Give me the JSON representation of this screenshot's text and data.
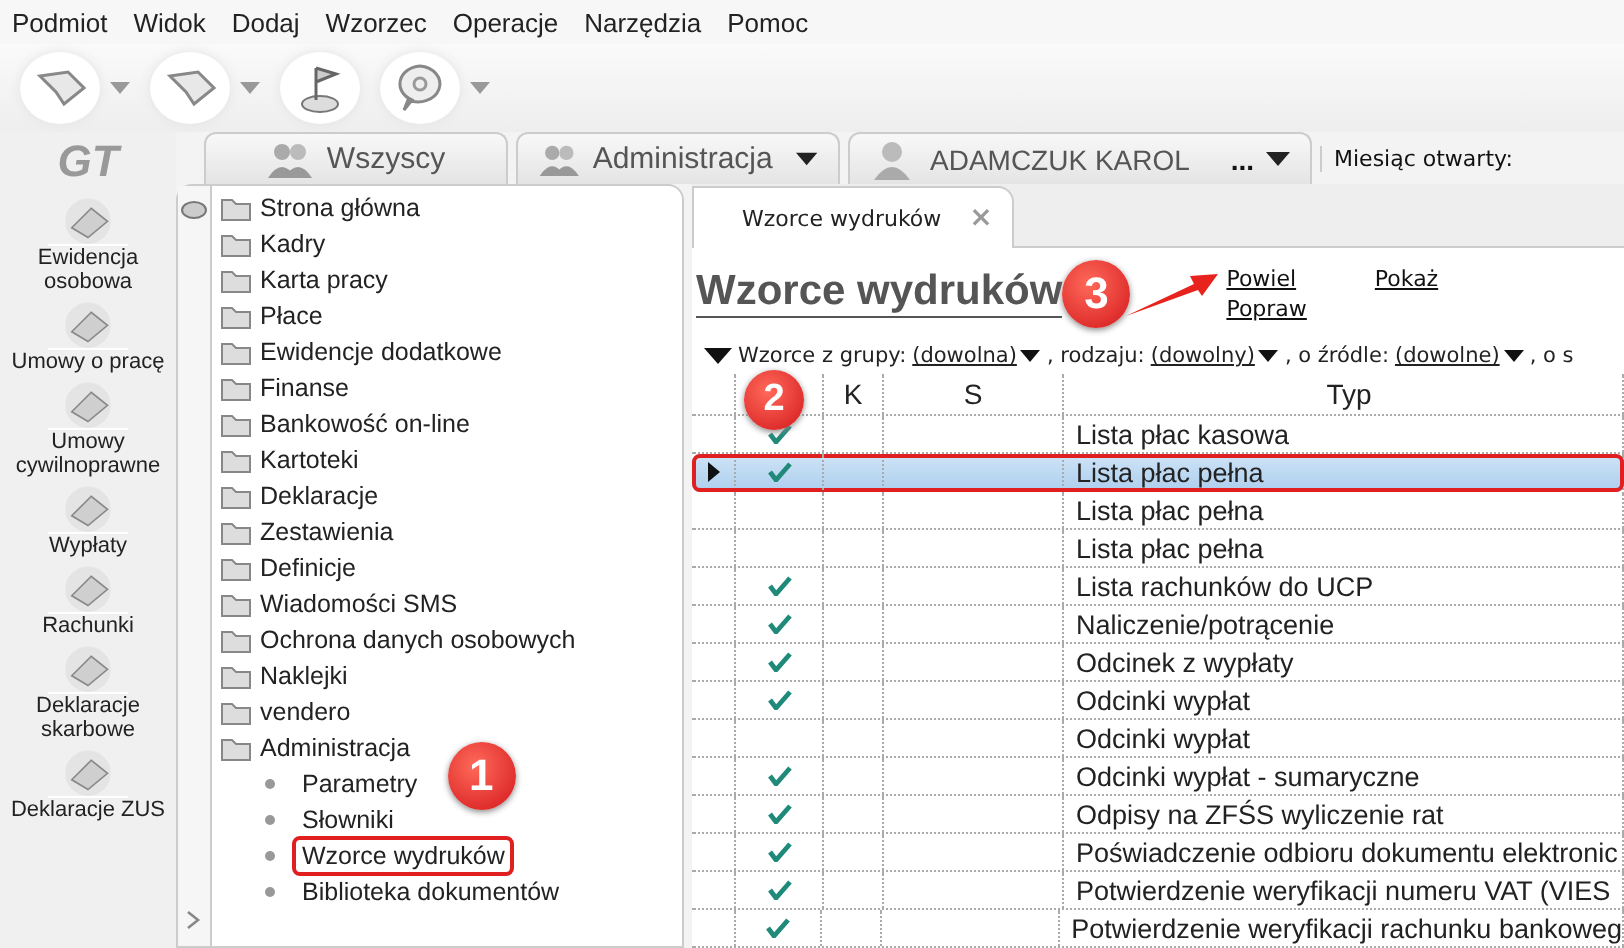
{
  "menu": [
    "Podmiot",
    "Widok",
    "Dodaj",
    "Wzorzec",
    "Operacje",
    "Narzędzia",
    "Pomoc"
  ],
  "toolbar": [
    {
      "kind": "arrow",
      "dropdown": true
    },
    {
      "kind": "arrow",
      "dropdown": true
    },
    {
      "kind": "flag",
      "dropdown": false
    },
    {
      "kind": "help",
      "dropdown": true
    }
  ],
  "top_tabs": [
    {
      "label": "Wszyscy",
      "kind": "group",
      "dropdown": false
    },
    {
      "label": "Administracja",
      "kind": "group",
      "dropdown": true
    },
    {
      "label": "ADAMCZUK KAROL",
      "kind": "person",
      "dropdown": true,
      "extra": "..."
    }
  ],
  "logo": "GT",
  "month_label": "Miesiąc otwarty:",
  "sidebar": [
    {
      "label": "Ewidencja osobowa"
    },
    {
      "label": "Umowy o pracę"
    },
    {
      "label": "Umowy cywilnoprawne"
    },
    {
      "label": "Wypłaty"
    },
    {
      "label": "Rachunki"
    },
    {
      "label": "Deklaracje skarbowe"
    },
    {
      "label": "Deklaracje ZUS"
    }
  ],
  "tree": [
    {
      "label": "Strona główna"
    },
    {
      "label": "Kadry"
    },
    {
      "label": "Karta pracy"
    },
    {
      "label": "Płace"
    },
    {
      "label": "Ewidencje dodatkowe"
    },
    {
      "label": "Finanse"
    },
    {
      "label": "Bankowość on-line"
    },
    {
      "label": "Kartoteki"
    },
    {
      "label": "Deklaracje"
    },
    {
      "label": "Zestawienia"
    },
    {
      "label": "Definicje"
    },
    {
      "label": "Wiadomości SMS"
    },
    {
      "label": "Ochrona danych osobowych"
    },
    {
      "label": "Naklejki"
    },
    {
      "label": "vendero"
    },
    {
      "label": "Administracja",
      "children": [
        {
          "label": "Parametry",
          "highlighted": false,
          "badge": "1"
        },
        {
          "label": "Słowniki",
          "highlighted": false
        },
        {
          "label": "Wzorce wydruków",
          "highlighted": true
        },
        {
          "label": "Biblioteka dokumentów",
          "highlighted": false
        }
      ]
    }
  ],
  "doc_tab": {
    "label": "Wzorce wydruków",
    "close": "×"
  },
  "title": "Wzorce wydruków",
  "title_badge": "3",
  "links": [
    {
      "label": "Powiel"
    },
    {
      "label": "Popraw"
    },
    {
      "label": "Pokaż"
    }
  ],
  "filter": [
    {
      "kind": "text",
      "label": "Wzorce z grupy:"
    },
    {
      "kind": "dropdown",
      "label": "(dowolna)"
    },
    {
      "kind": "text",
      "label": ", rodzaju:"
    },
    {
      "kind": "dropdown",
      "label": "(dowolny)"
    },
    {
      "kind": "text",
      "label": ", o źródle:"
    },
    {
      "kind": "dropdown",
      "label": "(dowolne)"
    },
    {
      "kind": "text",
      "label": ", o s"
    }
  ],
  "grid": {
    "badge": "2",
    "columns": [
      "K",
      "S",
      "Typ"
    ],
    "rows": [
      {
        "typ": "Lista płac kasowa",
        "checked": true,
        "selected": false,
        "highlighted": false
      },
      {
        "typ": "Lista płac pełna",
        "checked": true,
        "selected": true,
        "highlighted": true
      },
      {
        "typ": "Lista płac pełna",
        "checked": false,
        "selected": false,
        "highlighted": false
      },
      {
        "typ": "Lista płac pełna",
        "checked": false,
        "selected": false,
        "highlighted": false
      },
      {
        "typ": "Lista rachunków do UCP",
        "checked": true,
        "selected": false,
        "highlighted": false
      },
      {
        "typ": "Naliczenie/potrącenie",
        "checked": true,
        "selected": false,
        "highlighted": false
      },
      {
        "typ": "Odcinek z wypłaty",
        "checked": true,
        "selected": false,
        "highlighted": false
      },
      {
        "typ": "Odcinki wypłat",
        "checked": true,
        "selected": false,
        "highlighted": false
      },
      {
        "typ": "Odcinki wypłat",
        "checked": false,
        "selected": false,
        "highlighted": false
      },
      {
        "typ": "Odcinki wypłat - sumaryczne",
        "checked": true,
        "selected": false,
        "highlighted": false
      },
      {
        "typ": "Odpisy na ZFŚS wyliczenie rat",
        "checked": true,
        "selected": false,
        "highlighted": false
      },
      {
        "typ": "Poświadczenie odbioru dokumentu elektronic",
        "checked": true,
        "selected": false,
        "highlighted": false
      },
      {
        "typ": "Potwierdzenie weryfikacji numeru VAT (VIES",
        "checked": true,
        "selected": false,
        "highlighted": false
      },
      {
        "typ": "Potwierdzenie weryfikacji rachunku bankoweg",
        "checked": true,
        "selected": false,
        "highlighted": false
      }
    ]
  }
}
